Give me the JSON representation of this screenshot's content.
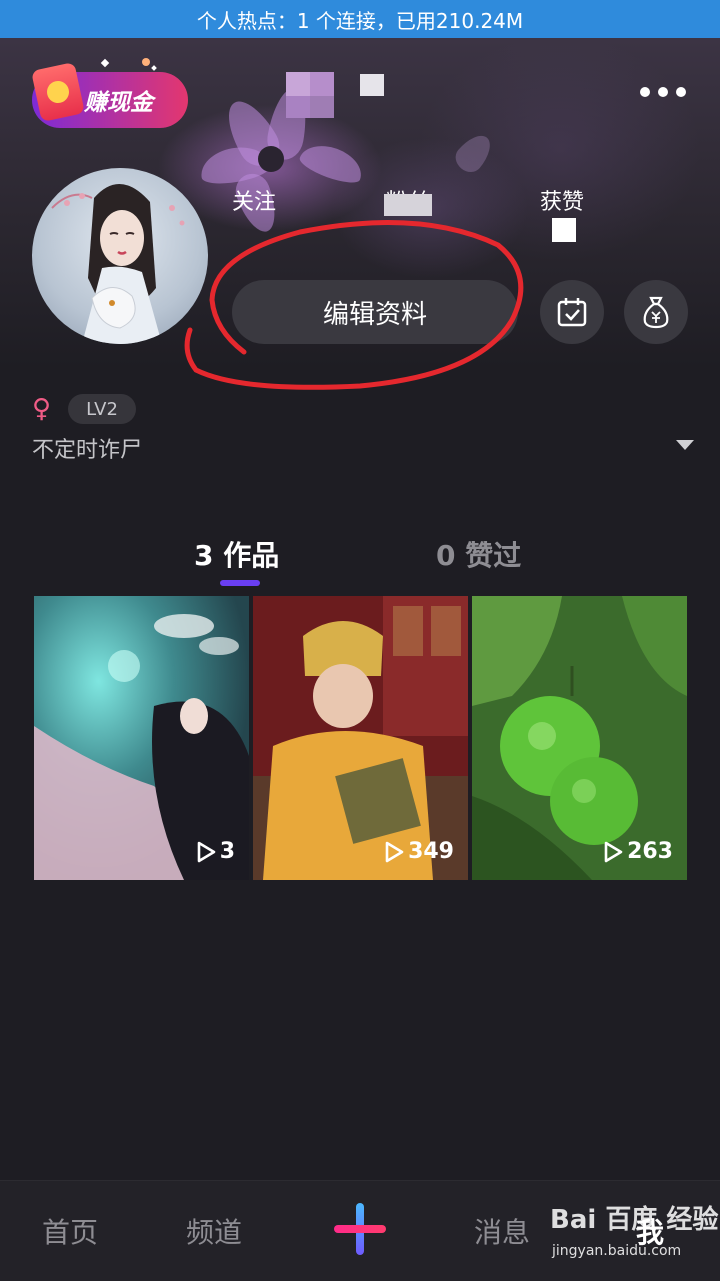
{
  "status_bar": {
    "hotspot_text": "个人热点：1 个连接，已用210.24M"
  },
  "header": {
    "earn_badge_label": "赚现金",
    "earn_icon": "red-envelope-icon",
    "more_icon": "more-dots-icon"
  },
  "profile": {
    "stats": [
      {
        "label": "关注"
      },
      {
        "label": "粉丝"
      },
      {
        "label": "获赞"
      }
    ],
    "edit_button_label": "编辑资料",
    "checkin_icon": "calendar-check-icon",
    "wallet_icon": "money-bag-icon",
    "gender_symbol": "♀",
    "level": "LV2",
    "bio": "不定时诈尸",
    "bio_toggle_icon": "triangle-down-icon"
  },
  "tabs": [
    {
      "label": "3 作品",
      "active": true
    },
    {
      "label": "0 赞过",
      "active": false
    }
  ],
  "videos": [
    {
      "play_count": "3"
    },
    {
      "play_count": "349"
    },
    {
      "play_count": "263"
    }
  ],
  "bottom_nav": {
    "items": [
      "首页",
      "频道",
      "消息",
      "我"
    ],
    "create_icon": "plus-icon",
    "watermark_text": "Bai 百度 经验",
    "watermark_url": "jingyan.baidu.com"
  },
  "colors": {
    "accent": "#6a3ff2",
    "annotation": "#e5282e",
    "hotspot_bar": "#2f8bdc",
    "background": "#1e1d23"
  }
}
